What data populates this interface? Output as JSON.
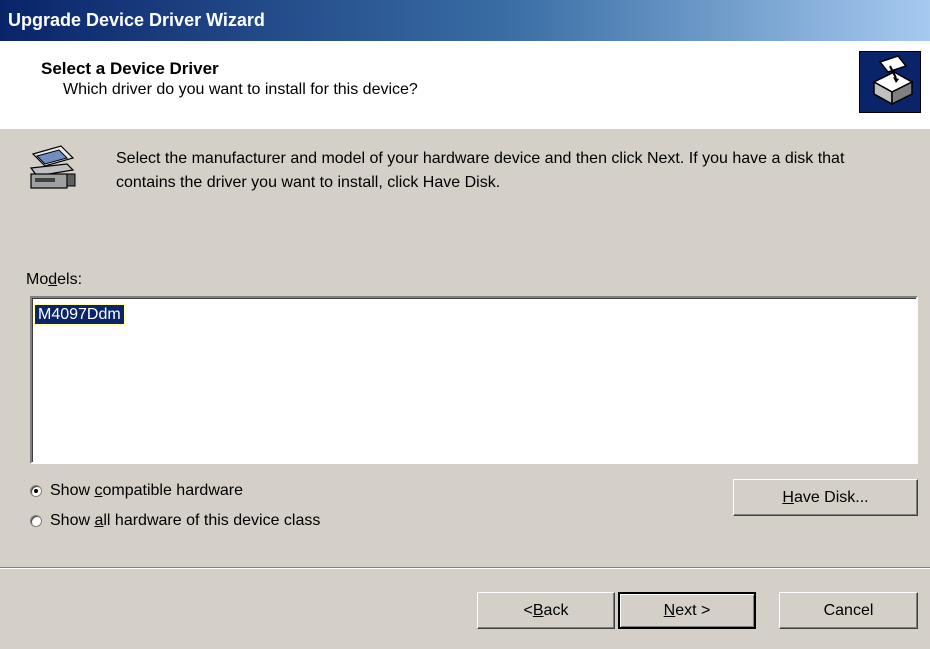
{
  "window": {
    "title": "Upgrade Device Driver Wizard"
  },
  "header": {
    "title": "Select a Device Driver",
    "subtitle": "Which driver do you want to install for this device?",
    "icon": "hardware-wizard-icon"
  },
  "intro": {
    "icon": "scanner-device-icon",
    "text": "Select the manufacturer and model of your hardware device and then click Next. If you have a disk that contains the driver you want to install, click Have Disk."
  },
  "models": {
    "label_prefix": "Mo",
    "label_accel": "d",
    "label_suffix": "els:",
    "items": [
      {
        "label": "M4097Ddm",
        "selected": true
      }
    ]
  },
  "options": {
    "compatible": {
      "prefix": "Show ",
      "accel": "c",
      "suffix": "ompatible hardware",
      "checked": true
    },
    "all": {
      "prefix": "Show ",
      "accel": "a",
      "suffix": "ll hardware of this device class",
      "checked": false
    }
  },
  "buttons": {
    "have_disk": {
      "accel": "H",
      "rest": "ave Disk..."
    },
    "back": {
      "pre": "< ",
      "accel": "B",
      "rest": "ack"
    },
    "next": {
      "accel": "N",
      "rest": "ext >"
    },
    "cancel": "Cancel"
  },
  "colors": {
    "title_bar": "#0a246a",
    "face": "#d4d0c8",
    "selection": "#0a246a"
  }
}
